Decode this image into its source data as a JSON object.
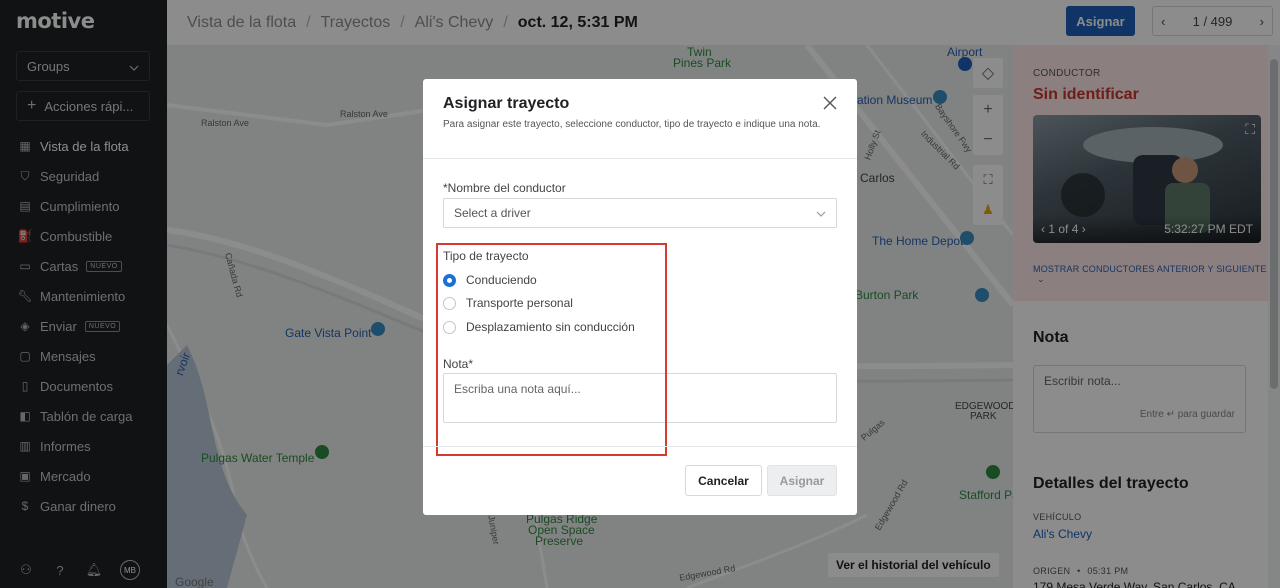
{
  "app": {
    "logo": "motive"
  },
  "sidebar": {
    "groups_label": "Groups",
    "quick_actions_label": "Acciones rápi...",
    "items": [
      {
        "label": "Vista de la flota",
        "icon": "map-icon",
        "active": true
      },
      {
        "label": "Seguridad",
        "icon": "shield-icon"
      },
      {
        "label": "Cumplimiento",
        "icon": "document-icon"
      },
      {
        "label": "Combustible",
        "icon": "fuel-icon"
      },
      {
        "label": "Cartas",
        "icon": "card-icon",
        "badge": "NUEVO"
      },
      {
        "label": "Mantenimiento",
        "icon": "wrench-icon"
      },
      {
        "label": "Enviar",
        "icon": "location-icon",
        "badge": "NUEVO"
      },
      {
        "label": "Mensajes",
        "icon": "chat-icon"
      },
      {
        "label": "Documentos",
        "icon": "file-icon"
      },
      {
        "label": "Tablón de carga",
        "icon": "board-icon"
      },
      {
        "label": "Informes",
        "icon": "chart-icon"
      },
      {
        "label": "Mercado",
        "icon": "market-icon"
      },
      {
        "label": "Ganar dinero",
        "icon": "dollar-icon"
      }
    ],
    "avatar_initials": "MB"
  },
  "header": {
    "breadcrumbs": [
      "Vista de la flota",
      "Trayectos",
      "Ali's Chevy"
    ],
    "current": "oct. 12, 5:31 PM",
    "assign_label": "Asignar",
    "pager": "1 / 499"
  },
  "map": {
    "labels": [
      "Twin",
      "Pines Park",
      "Airport",
      "ation Museum",
      "Carlos",
      "The Home Depot",
      "Burton Park",
      "Gate Vista Point",
      "Pulgas Water Temple",
      "EDGEWOOD",
      "PARK",
      "Stafford Pa",
      "Pulgas Ridge",
      "Open Space",
      "Preserve",
      "Ralston Ave",
      "Ralston Ave",
      "Industrial Rd",
      "Bayshore Fwy",
      "Holly St",
      "Cañada Rd",
      "Edgewood Rd",
      "Edgewood Rd",
      "Juniper",
      "Pulgas",
      "rvoir",
      "Google"
    ],
    "history_button": "Ver el historial del vehículo"
  },
  "right_panel": {
    "driver_label": "CONDUCTOR",
    "driver_name": "Sin identificar",
    "camera_counter": "1 of 4",
    "camera_time": "5:32:27 PM EDT",
    "show_more": "MOSTRAR CONDUCTORES ANTERIOR Y SIGUIENTE",
    "note_title": "Nota",
    "note_placeholder": "Escribir nota...",
    "note_hint": "Entre ↵ para guardar",
    "details_title": "Detalles del trayecto",
    "vehicle_label": "VEHÍCULO",
    "vehicle_value": "Ali's Chevy",
    "origin_label": "ORIGEN",
    "origin_time": "05:31 PM",
    "origin_address": "179 Mesa Verde Way, San Carlos, CA"
  },
  "modal": {
    "title": "Asignar trayecto",
    "description": "Para asignar este trayecto, seleccione conductor, tipo de trayecto e indique una nota.",
    "driver_field_label": "*Nombre del conductor",
    "driver_select_placeholder": "Select a driver",
    "trip_type_label": "Tipo de trayecto",
    "trip_types": [
      {
        "label": "Conduciendo",
        "checked": true
      },
      {
        "label": "Transporte personal",
        "checked": false
      },
      {
        "label": "Desplazamiento sin conducción",
        "checked": false
      }
    ],
    "note_label": "Nota*",
    "note_placeholder": "Escriba una nota aquí...",
    "cancel_label": "Cancelar",
    "assign_label": "Asignar"
  },
  "colors": {
    "sidebar_bg": "#1f2124",
    "accent": "#1c5fb8",
    "danger": "#c8352b",
    "highlight": "#d63b33"
  }
}
